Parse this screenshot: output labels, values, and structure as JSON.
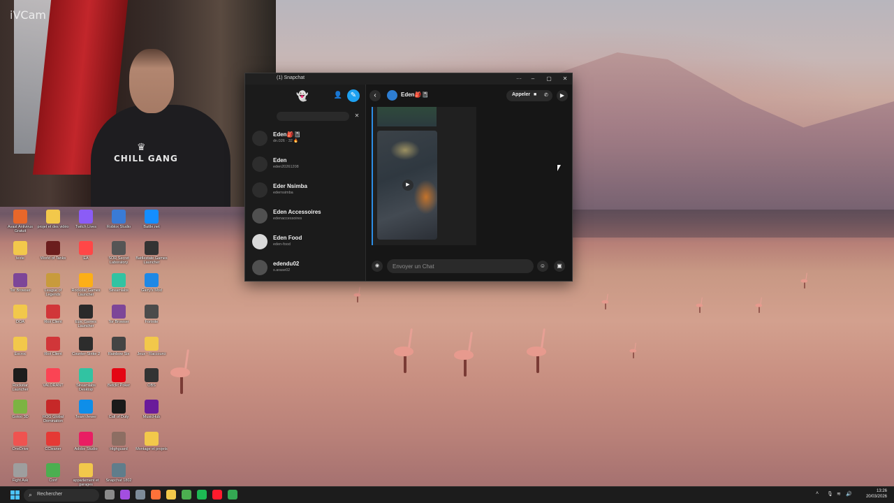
{
  "webcam": {
    "watermark": "iVCam",
    "shirt_text": "CHILL GANG"
  },
  "desktop_icons": [
    {
      "label": "Avast Antivirus Gratuit",
      "color": "#e8672a"
    },
    {
      "label": "projet et des vidéo",
      "color": "#f2c84b"
    },
    {
      "label": "Twitch Lives",
      "color": "#8b5cf6"
    },
    {
      "label": "Roblox Studio",
      "color": "#3a7bd5"
    },
    {
      "label": "Battle.net",
      "color": "#148eff"
    },
    {
      "label": "texte",
      "color": "#f2c84b"
    },
    {
      "label": "World of Tanks",
      "color": "#6b1d1d"
    },
    {
      "label": "EA",
      "color": "#ff4747"
    },
    {
      "label": "SOR Secret Laboratory",
      "color": "#555555"
    },
    {
      "label": "Battlestate Games Launcher",
      "color": "#333333"
    },
    {
      "label": "Tor Browser",
      "color": "#7d4698"
    },
    {
      "label": "League of Legends",
      "color": "#c89b3c"
    },
    {
      "label": "Rockstar Games Launcher",
      "color": "#fcaf17"
    },
    {
      "label": "Streamlabs",
      "color": "#31c3a2"
    },
    {
      "label": "Garry's Mod",
      "color": "#1e88e5"
    },
    {
      "label": "DOA",
      "color": "#f2c84b"
    },
    {
      "label": "Riot Client",
      "color": "#d13639"
    },
    {
      "label": "Epic Games Launcher",
      "color": "#2a2a2a"
    },
    {
      "label": "Tor Browser",
      "color": "#7d4698"
    },
    {
      "label": "Fortnite",
      "color": "#4b4b4b"
    },
    {
      "label": "Escroc",
      "color": "#f2c84b"
    },
    {
      "label": "Riot Client",
      "color": "#d13639"
    },
    {
      "label": "Counter-Strike 2",
      "color": "#2c2c2c"
    },
    {
      "label": "Rainbow Six",
      "color": "#444444"
    },
    {
      "label": "Jeux - Raccourci",
      "color": "#f2c84b"
    },
    {
      "label": "Rockstar Launcher",
      "color": "#1c1c1c"
    },
    {
      "label": "VALORANT",
      "color": "#fa4454"
    },
    {
      "label": "Streamlabs Desktop",
      "color": "#31c3a2"
    },
    {
      "label": "Betclic Poker",
      "color": "#e40613"
    },
    {
      "label": "OBS",
      "color": "#333333"
    },
    {
      "label": "Gotoo 3D",
      "color": "#7cb342"
    },
    {
      "label": "ROG Global Domination",
      "color": "#c62828"
    },
    {
      "label": "TeamViewer",
      "color": "#0e8ee9"
    },
    {
      "label": "Call of Duty",
      "color": "#1a1a1a"
    },
    {
      "label": "MusicHub",
      "color": "#6a1b9a"
    },
    {
      "label": "OneDrive",
      "color": "#ef5350"
    },
    {
      "label": "CCleaner",
      "color": "#e53935"
    },
    {
      "label": "Adobe Studio",
      "color": "#e91e63"
    },
    {
      "label": "Highguard",
      "color": "#8d6e63"
    },
    {
      "label": "Montage et projets",
      "color": "#f2c84b"
    },
    {
      "label": "Fight Ask",
      "color": "#9e9e9e"
    },
    {
      "label": "Conf",
      "color": "#4caf50"
    },
    {
      "label": "appartement et garages",
      "color": "#f2c84b"
    },
    {
      "label": "Snapchat 1802",
      "color": "#607d8b"
    }
  ],
  "snap": {
    "title": "(1) Snapchat",
    "window_controls": {
      "more": "···",
      "minimize": "–",
      "maximize": "▢",
      "close": "✕"
    },
    "chats": [
      {
        "name": "Eden🎒📓",
        "sub": "dn.026 · 32 🔥",
        "avatar_color": "#2d2d2d"
      },
      {
        "name": "Eden",
        "sub": "eden20261208",
        "avatar_color": "#2d2d2d"
      },
      {
        "name": "Eder Nsimba",
        "sub": "edernsimba",
        "avatar_color": "#2d2d2d"
      },
      {
        "name": "Eden Accessoires",
        "sub": "edenaccessoires",
        "avatar_color": "#505050"
      },
      {
        "name": "Eden Food",
        "sub": "eden-food",
        "avatar_color": "#d9d9d9"
      },
      {
        "name": "edendu02",
        "sub": "s.arase02",
        "avatar_color": "#505050"
      }
    ],
    "conversation": {
      "name": "Eden🎒📓",
      "call_label": "Appeler",
      "composer_placeholder": "Envoyer un Chat"
    }
  },
  "taskbar": {
    "search_placeholder": "Rechercher",
    "time": "13:26",
    "date": "20/03/2026",
    "apps": [
      {
        "name": "task-view",
        "color": "#8a8a8a"
      },
      {
        "name": "messenger",
        "color": "#a34ee0"
      },
      {
        "name": "settings",
        "color": "#7d8b99"
      },
      {
        "name": "firefox",
        "color": "#ff7139"
      },
      {
        "name": "file-explorer",
        "color": "#f2c84b"
      },
      {
        "name": "chrome",
        "color": "#4caf50"
      },
      {
        "name": "spotify",
        "color": "#1db954"
      },
      {
        "name": "opera",
        "color": "#ff1b2d"
      },
      {
        "name": "chrome-2",
        "color": "#34a853"
      }
    ]
  }
}
